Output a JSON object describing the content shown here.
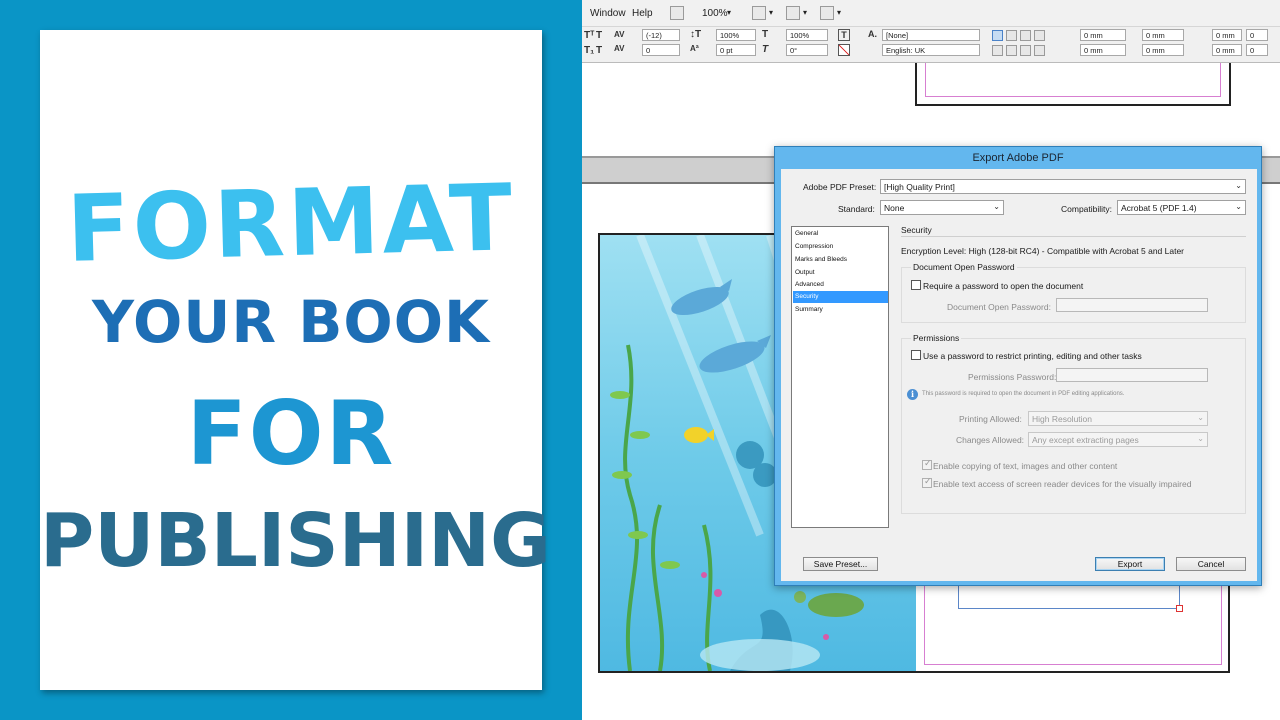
{
  "promo": {
    "line1": "FORMAT",
    "line2": "YOUR BOOK",
    "line3": "FOR",
    "line4": "PUBLISHING",
    "colors": {
      "panel": "#0a95c6",
      "line1": "#3cc0ef",
      "line2": "#1d6eb5",
      "line3": "#1d96d2",
      "line4": "#2a6c8e"
    }
  },
  "menubar": {
    "items": [
      "Window",
      "Help"
    ],
    "zoom": "100%"
  },
  "controlbar": {
    "tracking": "(-12)",
    "kerning": "0",
    "vertical_scale": "100%",
    "baseline_shift": "0 pt",
    "horizontal_scale": "100%",
    "skew": "0°",
    "char_style": "[None]",
    "language": "English: UK",
    "left_indent": "0 mm",
    "first_line_indent": "0 mm",
    "right_indent": "0 mm",
    "last_line_indent": "0 mm",
    "space_before": "0 mm",
    "space_after": "0 mm",
    "drop_cap_lines": "0",
    "drop_cap_chars": "0"
  },
  "dialog": {
    "title": "Export Adobe PDF",
    "preset_label": "Adobe PDF Preset:",
    "preset_value": "[High Quality Print]",
    "standard_label": "Standard:",
    "standard_value": "None",
    "compatibility_label": "Compatibility:",
    "compatibility_value": "Acrobat 5 (PDF 1.4)",
    "nav": [
      "General",
      "Compression",
      "Marks and Bleeds",
      "Output",
      "Advanced",
      "Security",
      "Summary"
    ],
    "nav_selected": "Security",
    "section_title": "Security",
    "encryption_text": "Encryption Level: High (128-bit RC4) - Compatible with Acrobat 5 and Later",
    "open_password_group": "Document Open Password",
    "require_open_password": "Require a password to open the document",
    "open_password_label": "Document Open Password:",
    "permissions_group": "Permissions",
    "restrict_password": "Use a password to restrict printing, editing and other tasks",
    "permissions_password_label": "Permissions Password:",
    "info_note": "This password is required to open the document in PDF editing applications.",
    "printing_label": "Printing Allowed:",
    "printing_value": "High Resolution",
    "changes_label": "Changes Allowed:",
    "changes_value": "Any except extracting pages",
    "enable_copying": "Enable copying of text, images and other content",
    "enable_access": "Enable text access of screen reader devices for the visually impaired",
    "save_preset": "Save Preset...",
    "export": "Export",
    "cancel": "Cancel"
  }
}
